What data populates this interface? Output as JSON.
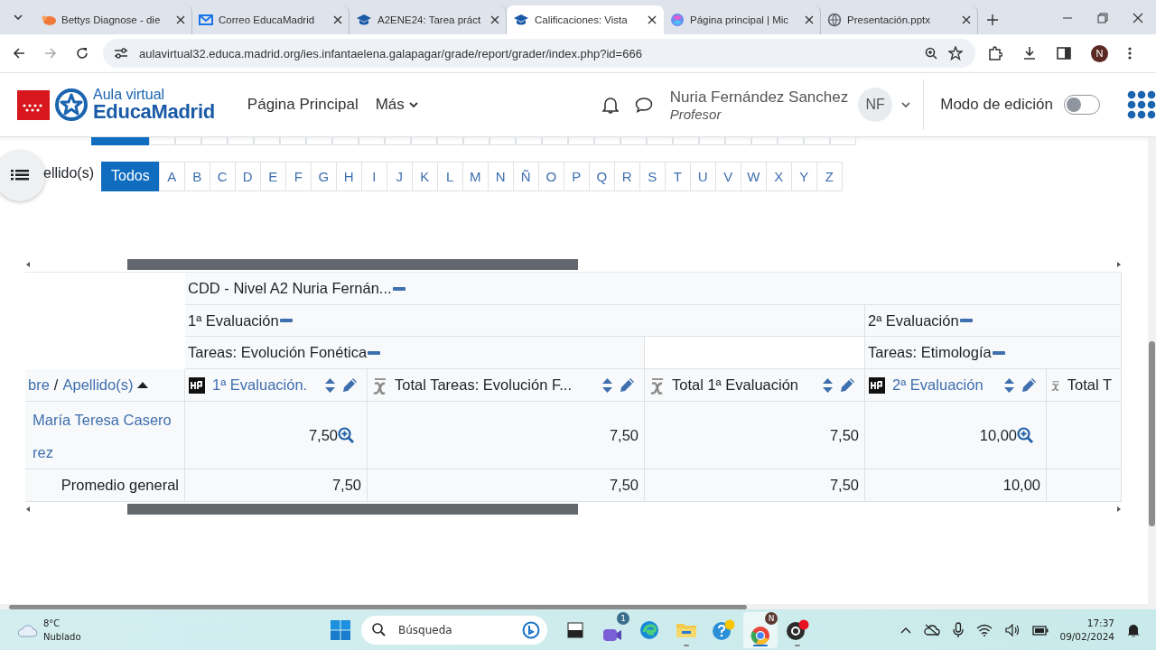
{
  "browser": {
    "tabs": [
      {
        "title": "Bettys Diagnose - die",
        "kind": "blob",
        "selected": false
      },
      {
        "title": "Correo EducaMadrid",
        "kind": "mail",
        "selected": false
      },
      {
        "title": "A2ENE24: Tarea práct",
        "kind": "cap",
        "selected": false
      },
      {
        "title": "Calificaciones: Vista",
        "kind": "cap",
        "selected": true
      },
      {
        "title": "Página principal | Mic",
        "kind": "swirl",
        "selected": false
      },
      {
        "title": "Presentación.pptx",
        "kind": "globe",
        "selected": false
      }
    ],
    "url": "aulavirtual32.educa.madrid.org/ies.infantaelena.galapagar/grade/report/grader/index.php?id=666",
    "profile_initial": "N"
  },
  "site": {
    "brand_top": "Aula virtual",
    "brand_bottom": "EducaMadrid",
    "nav": [
      {
        "label": "Página Principal",
        "kind": "link"
      },
      {
        "label": "Más",
        "kind": "menu"
      }
    ],
    "user": {
      "name": "Nuria Fernández Sanchez",
      "role": "Profesor",
      "initials": "NF"
    },
    "edit_mode": {
      "label": "Modo de edición",
      "on": false
    }
  },
  "filter": {
    "label": "ellido(s)",
    "letters": [
      {
        "label": "Todos",
        "selected": true
      },
      {
        "label": "A",
        "selected": false
      },
      {
        "label": "B",
        "selected": false
      },
      {
        "label": "C",
        "selected": false
      },
      {
        "label": "D",
        "selected": false
      },
      {
        "label": "E",
        "selected": false
      },
      {
        "label": "F",
        "selected": false
      },
      {
        "label": "G",
        "selected": false
      },
      {
        "label": "H",
        "selected": false
      },
      {
        "label": "I",
        "selected": false
      },
      {
        "label": "J",
        "selected": false
      },
      {
        "label": "K",
        "selected": false
      },
      {
        "label": "L",
        "selected": false
      },
      {
        "label": "M",
        "selected": false
      },
      {
        "label": "N",
        "selected": false
      },
      {
        "label": "Ñ",
        "selected": false
      },
      {
        "label": "O",
        "selected": false
      },
      {
        "label": "P",
        "selected": false
      },
      {
        "label": "Q",
        "selected": false
      },
      {
        "label": "R",
        "selected": false
      },
      {
        "label": "S",
        "selected": false
      },
      {
        "label": "T",
        "selected": false
      },
      {
        "label": "U",
        "selected": false
      },
      {
        "label": "V",
        "selected": false
      },
      {
        "label": "W",
        "selected": false
      },
      {
        "label": "X",
        "selected": false
      },
      {
        "label": "Y",
        "selected": false
      },
      {
        "label": "Z",
        "selected": false
      }
    ]
  },
  "grader": {
    "course": "CDD - Nivel A2 Nuria Fernán...",
    "evaluations": [
      {
        "label": "1ª Evaluación",
        "groups": [
          {
            "label": "Tareas: Evolución Fonética",
            "columns": [
              {
                "kind": "item",
                "label": "1ª Evaluación.",
                "sortable": true
              },
              {
                "kind": "total",
                "label": "Total Tareas: Evolución F...",
                "sortable": true
              }
            ]
          },
          {
            "columns": [
              {
                "kind": "total",
                "label": "Total 1ª Evaluación",
                "sortable": true
              }
            ]
          }
        ]
      },
      {
        "label": "2ª Evaluación",
        "groups": [
          {
            "label": "Tareas: Etimología",
            "columns": [
              {
                "kind": "item",
                "label": "2ª Evaluación",
                "sortable": true
              },
              {
                "kind": "total",
                "label": "Total T",
                "sortable": false
              }
            ]
          }
        ]
      }
    ],
    "user_header": {
      "first": "bre",
      "separator": "/",
      "last": "Apellido(s)"
    },
    "rows": [
      {
        "kind": "student",
        "name": "María Teresa Casero rez",
        "values": [
          "7,50",
          "7,50",
          "7,50",
          "10,00"
        ]
      },
      {
        "kind": "average",
        "name": "Promedio general",
        "values": [
          "7,50",
          "7,50",
          "7,50",
          "10,00"
        ]
      }
    ]
  },
  "taskbar": {
    "weather": {
      "temp": "8°C",
      "desc": "Nublado"
    },
    "search": {
      "placeholder": "Búsqueda"
    },
    "apps": [
      {
        "kind": "taskview",
        "selected": false,
        "running": false
      },
      {
        "kind": "chat",
        "badge": "1",
        "selected": false,
        "running": false
      },
      {
        "kind": "edge",
        "selected": false,
        "running": false
      },
      {
        "kind": "folder",
        "selected": false,
        "running": true
      },
      {
        "kind": "help",
        "selected": false,
        "running": false
      },
      {
        "kind": "chrome",
        "badge": "N",
        "selected": true,
        "running": true
      },
      {
        "kind": "record",
        "selected": false,
        "running": true
      }
    ],
    "time": "17:37",
    "date": "09/02/2024"
  }
}
